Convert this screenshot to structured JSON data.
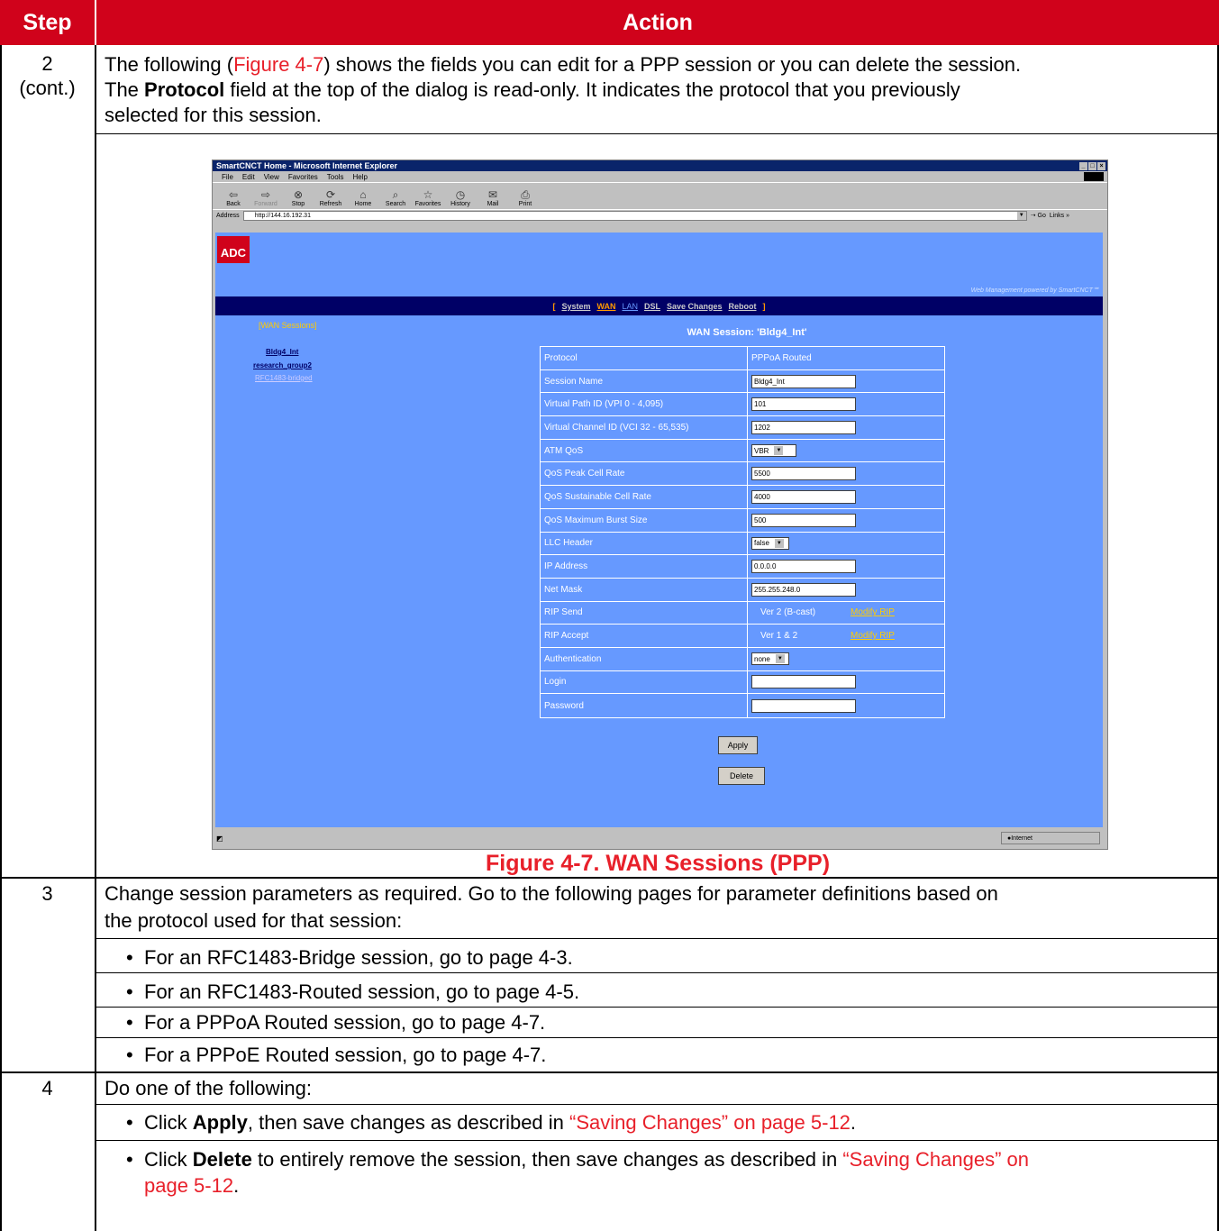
{
  "table": {
    "header_step": "Step",
    "header_action": "Action"
  },
  "rows": {
    "step2": {
      "num": "2",
      "cont": "(cont.)",
      "line1_a": "The following (",
      "line1_link": "Figure 4-7",
      "line1_b": ") shows the fields you can edit for a PPP session or you can delete the session.",
      "line2_a": "The ",
      "line2_bold": "Protocol",
      "line2_b": " field at the top of the dialog is read-only. It indicates the protocol that you previously",
      "line3": "selected for this session.",
      "caption": "Figure 4-7. WAN Sessions (PPP)"
    },
    "step3": {
      "num": "3",
      "line1": "Change session parameters as required. Go to the following pages for parameter definitions based on",
      "line2": "the protocol used for that session:",
      "bullets": [
        "For an RFC1483-Bridge session, go to page 4-3.",
        "For an RFC1483-Routed session, go to page 4-5.",
        "For a PPPoA Routed session, go to page 4-7.",
        "For a PPPoE Routed session, go to page 4-7."
      ]
    },
    "step4": {
      "num": "4",
      "line1": "Do one of the following:",
      "b1_a": "Click ",
      "b1_bold": "Apply",
      "b1_b": ", then save changes as described in ",
      "b1_link": "“Saving Changes” on page 5-12",
      "b1_c": ".",
      "b2_a": "Click ",
      "b2_bold": "Delete",
      "b2_b": " to entirely remove the session, then save changes as described in ",
      "b2_link1": "“Saving Changes” on",
      "b2_link2": "page 5-12",
      "b2_c": "."
    }
  },
  "browser": {
    "title": "SmartCNCT Home - Microsoft Internet Explorer",
    "menu": [
      "File",
      "Edit",
      "View",
      "Favorites",
      "Tools",
      "Help"
    ],
    "toolbar": [
      "Back",
      "Forward",
      "Stop",
      "Refresh",
      "Home",
      "Search",
      "Favorites",
      "History",
      "Mail",
      "Print"
    ],
    "address_label": "Address",
    "address": "http://144.16.192.31",
    "go": "Go",
    "links": "Links",
    "status_zone": "Internet"
  },
  "app": {
    "logo": "ADC",
    "powered": "Web Management powered by SmartCNCT℠",
    "nav_open": "[",
    "nav_close": "]",
    "nav": [
      "System",
      "WAN",
      "LAN",
      "DSL",
      "Save Changes",
      "Reboot"
    ],
    "sidebar_title": "[WAN Sessions]",
    "sessions": [
      "Bldg4_Int",
      "research_group2",
      "RFC1483-bridged"
    ],
    "heading": "WAN Session: 'Bldg4_Int'",
    "fields": {
      "protocol": {
        "label": "Protocol",
        "value": "PPPoA Routed"
      },
      "session_name": {
        "label": "Session Name",
        "value": "Bldg4_Int"
      },
      "vpi": {
        "label": "Virtual Path ID (VPI 0 - 4,095)",
        "value": "101"
      },
      "vci": {
        "label": "Virtual Channel ID (VCI 32 - 65,535)",
        "value": "1202"
      },
      "atm_qos": {
        "label": "ATM QoS",
        "value": "VBR"
      },
      "peak": {
        "label": "QoS Peak Cell Rate",
        "value": "5500"
      },
      "sustainable": {
        "label": "QoS Sustainable Cell Rate",
        "value": "4000"
      },
      "burst": {
        "label": "QoS Maximum Burst Size",
        "value": "500"
      },
      "llc": {
        "label": "LLC Header",
        "value": "false"
      },
      "ip": {
        "label": "IP Address",
        "value": "0.0.0.0"
      },
      "mask": {
        "label": "Net Mask",
        "value": "255.255.248.0"
      },
      "rip_send": {
        "label": "RIP Send",
        "value": "Ver 2 (B-cast)",
        "link": "Modify RIP"
      },
      "rip_accept": {
        "label": "RIP Accept",
        "value": "Ver 1  & 2",
        "link": "Modify RIP"
      },
      "auth": {
        "label": "Authentication",
        "value": "none"
      },
      "login": {
        "label": "Login",
        "value": ""
      },
      "password": {
        "label": "Password",
        "value": ""
      }
    },
    "apply": "Apply",
    "delete": "Delete"
  }
}
